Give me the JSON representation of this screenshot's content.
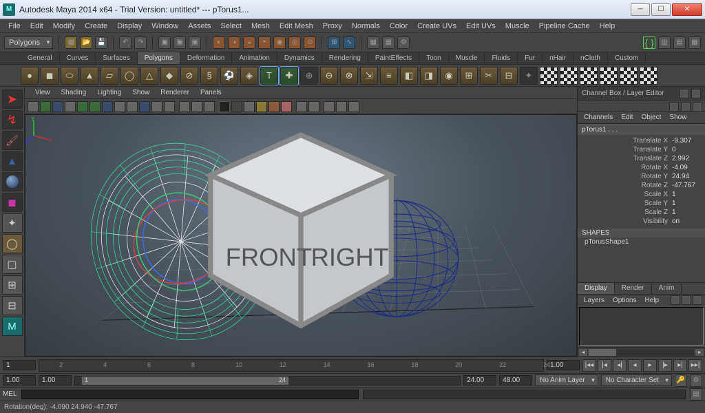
{
  "window": {
    "title": "Autodesk Maya 2014 x64 - Trial Version: untitled*  ---  pTorus1...",
    "logo": "M"
  },
  "menubar": [
    "File",
    "Edit",
    "Modify",
    "Create",
    "Display",
    "Window",
    "Assets",
    "Select",
    "Mesh",
    "Edit Mesh",
    "Proxy",
    "Normals",
    "Color",
    "Create UVs",
    "Edit UVs",
    "Muscle",
    "Pipeline Cache",
    "Help"
  ],
  "mode_dropdown": "Polygons",
  "shelf_tabs": [
    "General",
    "Curves",
    "Surfaces",
    "Polygons",
    "Deformation",
    "Animation",
    "Dynamics",
    "Rendering",
    "PaintEffects",
    "Toon",
    "Muscle",
    "Fluids",
    "Fur",
    "nHair",
    "nCloth",
    "Custom"
  ],
  "shelf_active": "Polygons",
  "view_menubar": [
    "View",
    "Shading",
    "Lighting",
    "Show",
    "Renderer",
    "Panels"
  ],
  "channel_box": {
    "title": "Channel Box / Layer Editor",
    "menus": [
      "Channels",
      "Edit",
      "Object",
      "Show"
    ],
    "object": "pTorus1 . . .",
    "attrs": [
      {
        "label": "Translate X",
        "val": "-9.307"
      },
      {
        "label": "Translate Y",
        "val": "0"
      },
      {
        "label": "Translate Z",
        "val": "2.992"
      },
      {
        "label": "Rotate X",
        "val": "-4.09"
      },
      {
        "label": "Rotate Y",
        "val": "24.94"
      },
      {
        "label": "Rotate Z",
        "val": "-47.767"
      },
      {
        "label": "Scale X",
        "val": "1"
      },
      {
        "label": "Scale Y",
        "val": "1"
      },
      {
        "label": "Scale Z",
        "val": "1"
      },
      {
        "label": "Visibility",
        "val": "on"
      }
    ],
    "shapes_hdr": "SHAPES",
    "shape": "pTorusShape1"
  },
  "layer_tabs": [
    "Display",
    "Render",
    "Anim"
  ],
  "layer_active": "Display",
  "layer_menus": [
    "Layers",
    "Options",
    "Help"
  ],
  "timeline": {
    "start_vis": "1",
    "end_vis": "1.00",
    "ticks": [
      "2",
      "4",
      "6",
      "8",
      "10",
      "12",
      "14",
      "16",
      "18",
      "20",
      "22",
      "24"
    ]
  },
  "range": {
    "start": "1.00",
    "anim_start": "1.00",
    "slider_start": "1",
    "slider_end": "24",
    "anim_end": "24.00",
    "end": "48.00",
    "anim_layer": "No Anim Layer",
    "char_set": "No Character Set"
  },
  "mel_label": "MEL",
  "status": "Rotation(deg):    -4.090    24.940    -47.767",
  "viewcube": {
    "front": "FRONT",
    "right": "RIGHT"
  }
}
